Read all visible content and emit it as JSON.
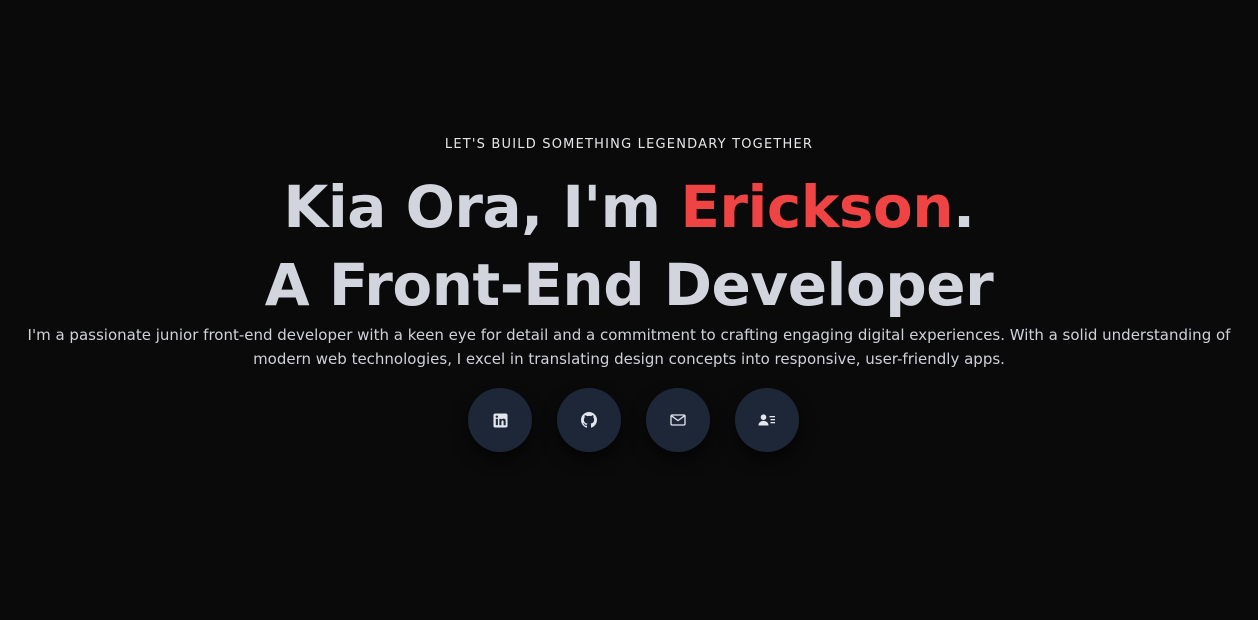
{
  "hero": {
    "eyebrow": "LET'S BUILD SOMETHING LEGENDARY TOGETHER",
    "greeting_prefix": "Kia Ora, I'm ",
    "name": "Erickson",
    "greeting_suffix": ".",
    "role_line": "A Front-End Developer",
    "description": "I'm a passionate junior front-end developer with a keen eye for detail and a commitment to crafting engaging digital experiences. With a solid understanding of modern web technologies, I excel in translating design concepts into responsive, user-friendly apps."
  },
  "socials": [
    {
      "icon": "linkedin-icon"
    },
    {
      "icon": "github-icon"
    },
    {
      "icon": "mail-icon"
    },
    {
      "icon": "contact-card-icon"
    }
  ],
  "colors": {
    "background": "#0a0a0a",
    "heading": "#d3d5de",
    "accent": "#f04444",
    "button_bg": "#1e2738"
  }
}
